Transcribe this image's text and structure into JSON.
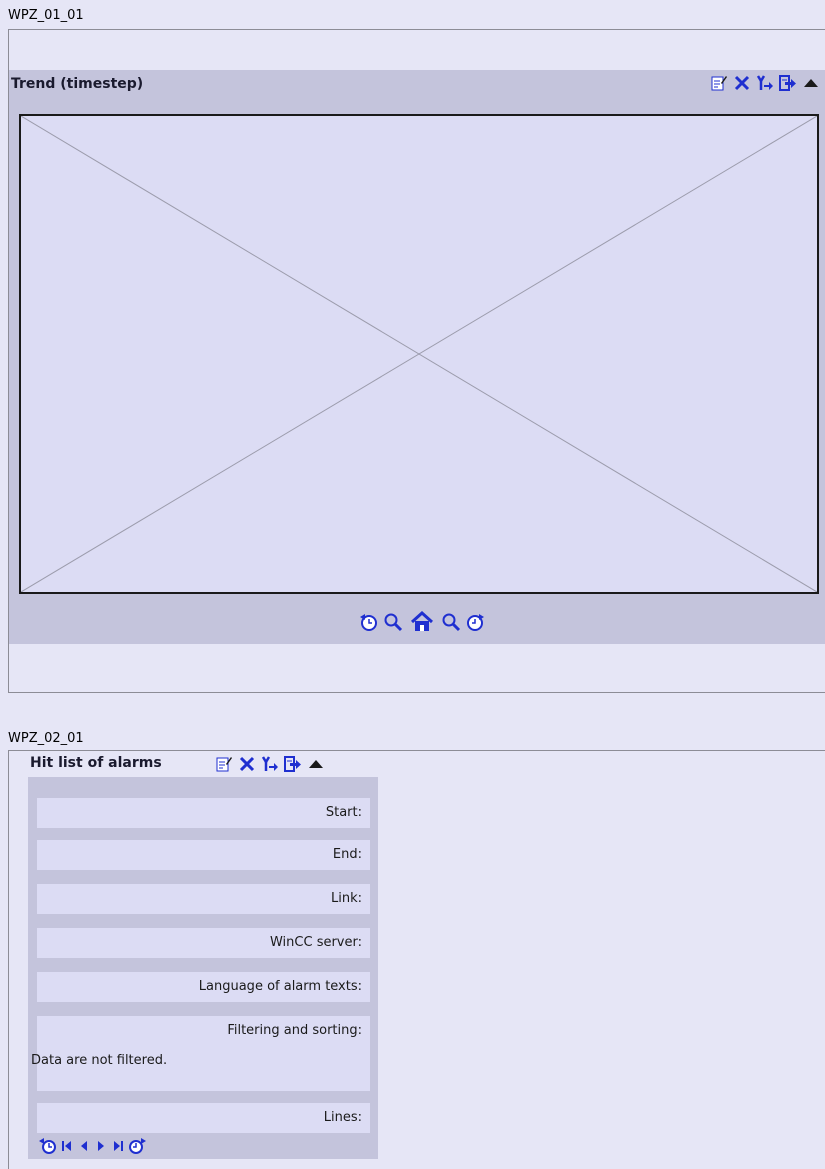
{
  "zones": [
    {
      "label": "WPZ_01_01"
    },
    {
      "label": "WPZ_02_01"
    }
  ],
  "trend": {
    "title": "Trend (timestep)",
    "toolbar": [
      "edit-icon",
      "close-icon",
      "connect-icon",
      "export-icon",
      "collapse-icon"
    ],
    "nav": [
      "rewind-time-icon",
      "zoom-out-icon",
      "home-icon",
      "zoom-in-icon",
      "forward-time-icon"
    ]
  },
  "alarms": {
    "title": "Hit list of alarms",
    "fields": {
      "start": "Start:",
      "end": "End:",
      "link": "Link:",
      "server": "WinCC server:",
      "language": "Language of alarm texts:",
      "filtering": "Filtering and sorting:",
      "filtering_value": "Data are not filtered.",
      "lines": "Lines:"
    },
    "nav": [
      "time-back-icon",
      "first-page-icon",
      "prev-page-icon",
      "next-page-icon",
      "last-page-icon",
      "time-forward-icon"
    ]
  },
  "colors": {
    "background": "#e6e6f6",
    "panel": "#c4c4dc",
    "field": "#dcdcf4",
    "icon_blue": "#1f2fd0"
  }
}
